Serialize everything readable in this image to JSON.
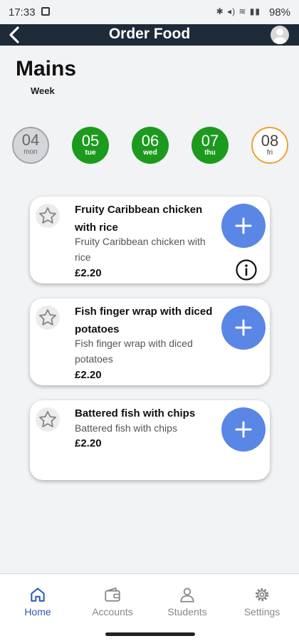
{
  "status_bar": {
    "time": "17:33",
    "icons": "✱ ◂) ≋ ▮▮",
    "battery": "98%"
  },
  "app_bar": {
    "title": "Order Food"
  },
  "header": {
    "title": "Mains",
    "subtitle": "Week"
  },
  "days": [
    {
      "num": "04",
      "name": "mon",
      "state": "past"
    },
    {
      "num": "05",
      "name": "tue",
      "state": "available"
    },
    {
      "num": "06",
      "name": "wed",
      "state": "available"
    },
    {
      "num": "07",
      "name": "thu",
      "state": "available"
    },
    {
      "num": "08",
      "name": "fri",
      "state": "selected"
    }
  ],
  "menu_items": [
    {
      "name": "Fruity Caribbean chicken with rice",
      "description": "Fruity Caribbean chicken with rice",
      "price": "£2.20",
      "has_info": true
    },
    {
      "name": "Fish finger wrap with diced potatoes",
      "description": "Fish finger wrap with diced potatoes",
      "price": "£2.20",
      "has_info": false
    },
    {
      "name": "Battered fish with chips",
      "description": "Battered fish with chips",
      "price": "£2.20",
      "has_info": false
    }
  ],
  "nav": [
    {
      "label": "Home",
      "icon": "home-icon",
      "active": true
    },
    {
      "label": "Accounts",
      "icon": "wallet-icon",
      "active": false
    },
    {
      "label": "Students",
      "icon": "person-icon",
      "active": false
    },
    {
      "label": "Settings",
      "icon": "gear-icon",
      "active": false
    }
  ],
  "colors": {
    "app_bar": "#1e2a38",
    "available_day": "#1c9a1e",
    "selected_day_border": "#f0a030",
    "add_button": "#5a86e6",
    "nav_active": "#2c5ab7"
  }
}
